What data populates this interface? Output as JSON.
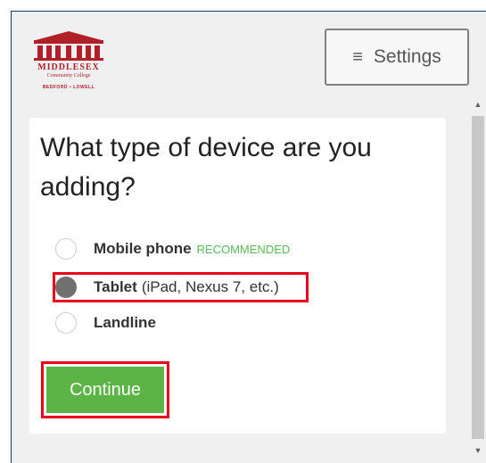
{
  "header": {
    "logo": {
      "name": "MIDDLESEX",
      "subtitle": "Community College",
      "locations": "BEDFORD • LOWELL",
      "color": "#b12029"
    },
    "settings_icon": "menu-icon",
    "settings_label": "Settings"
  },
  "prompt": {
    "question": "What type of device are you adding?"
  },
  "options": [
    {
      "label": "Mobile phone",
      "detail": "",
      "badge": "RECOMMENDED",
      "selected": false
    },
    {
      "label": "Tablet",
      "detail": "(iPad, Nexus 7, etc.)",
      "badge": "",
      "selected": true
    },
    {
      "label": "Landline",
      "detail": "",
      "badge": "",
      "selected": false
    }
  ],
  "actions": {
    "continue_label": "Continue"
  },
  "colors": {
    "accent_green": "#5cb346",
    "recommended_green": "#5cb85c",
    "highlight_red": "#e8001c"
  }
}
